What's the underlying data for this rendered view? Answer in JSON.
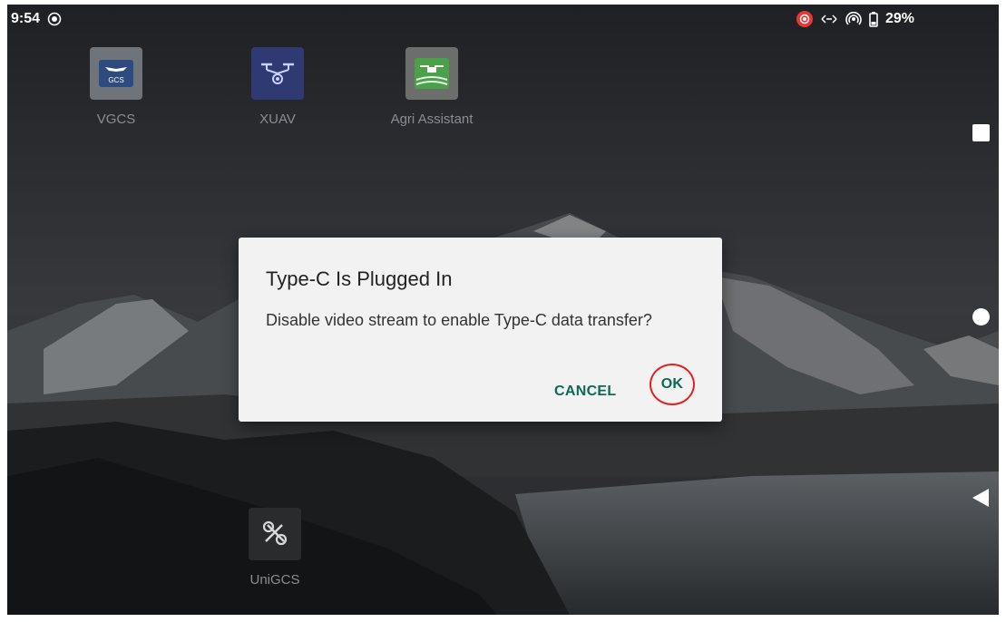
{
  "status_bar": {
    "time": "9:54",
    "battery": "29%",
    "icons": [
      "record-icon",
      "usb-transfer-icon",
      "hotspot-icon",
      "battery-icon"
    ]
  },
  "apps": [
    {
      "label": "VGCS",
      "icon": "vgcs-app-icon",
      "badge": "GCS"
    },
    {
      "label": "XUAV",
      "icon": "drone-app-icon"
    },
    {
      "label": "Agri Assistant",
      "icon": "agri-drone-app-icon"
    },
    {
      "label": "UniGCS",
      "icon": "unigcs-app-icon"
    }
  ],
  "dialog": {
    "title": "Type-C Is Plugged In",
    "message": "Disable video stream to enable Type-C data transfer?",
    "cancel_label": "CANCEL",
    "ok_label": "OK"
  },
  "nav": [
    "recents-icon",
    "home-icon",
    "back-icon"
  ],
  "colors": {
    "accent": "#0e6a53",
    "highlight": "#e02020",
    "record": "#e53935"
  }
}
